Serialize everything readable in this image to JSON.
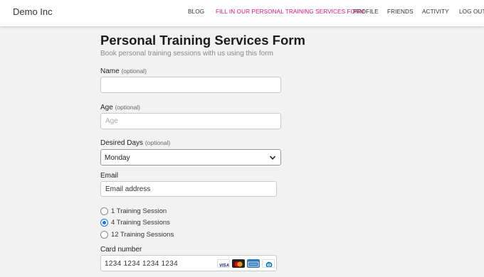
{
  "navbar": {
    "brand": "Demo Inc",
    "links": [
      "BLOG",
      "FILL IN OUR PERSONAL TRAINING SERVICES FORM",
      "PROFILE",
      "FRIENDS",
      "ACTIVITY",
      "LOG OUT"
    ],
    "active_color": "#e6157a"
  },
  "form": {
    "title": "Personal Training Services Form",
    "subtitle": "Book personal training sessions with us using this form",
    "name": {
      "label": "Name",
      "optional": "(optional)",
      "value": ""
    },
    "age": {
      "label": "Age",
      "optional": "(optional)",
      "placeholder": "Age"
    },
    "days": {
      "label": "Desired Days",
      "optional": "(optional)",
      "selected": "Monday"
    },
    "email": {
      "label": "Email",
      "placeholder": "Email address"
    },
    "sessions": [
      {
        "label": "1 Training Session",
        "checked": false
      },
      {
        "label": "4 Training Sessions",
        "checked": true
      },
      {
        "label": "12 Training Sessions",
        "checked": false
      }
    ],
    "card": {
      "label": "Card number",
      "placeholder": "1234 1234 1234 1234",
      "brands": [
        "visa-icon",
        "mastercard-icon",
        "amex-icon",
        "diners-icon"
      ]
    }
  }
}
